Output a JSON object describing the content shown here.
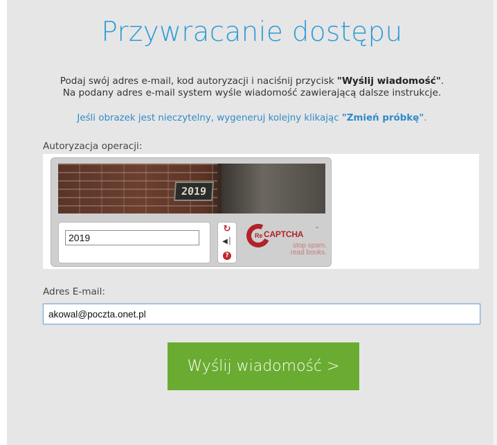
{
  "header": {
    "title": "Przywracanie dostępu"
  },
  "intro": {
    "line1_prefix": "Podaj swój adres e-mail, kod autoryzacji i naciśnij przycisk ",
    "line1_bold": "\"Wyślij wiadomość\"",
    "line1_suffix": ".",
    "line2": "Na podany adres e-mail system wyśle wiadomość zawierającą dalsze instrukcje."
  },
  "hint": {
    "prefix": "Jeśli obrazek jest nieczytelny, wygeneruj kolejny klikając ",
    "bold": "\"Zmień próbkę\"",
    "suffix": "."
  },
  "captcha": {
    "label": "Autoryzacja operacji:",
    "image_text": "2019",
    "input_value": "2019",
    "reload_icon": "refresh-icon",
    "audio_icon": "audio-icon",
    "help_icon": "help-icon",
    "logo": {
      "re": "Re",
      "name": "CAPTCHA",
      "tm": "™",
      "tagline1": "stop spam.",
      "tagline2": "read books."
    },
    "accent_color": "#b0232a"
  },
  "email": {
    "label": "Adres E-mail:",
    "value": "akowal@poczta.onet.pl"
  },
  "submit": {
    "label": "Wyślij wiadomość >",
    "color": "#6aac31"
  },
  "colors": {
    "title": "#2e9bd6",
    "link": "#2e8bc9",
    "background": "#e6e6e6"
  }
}
